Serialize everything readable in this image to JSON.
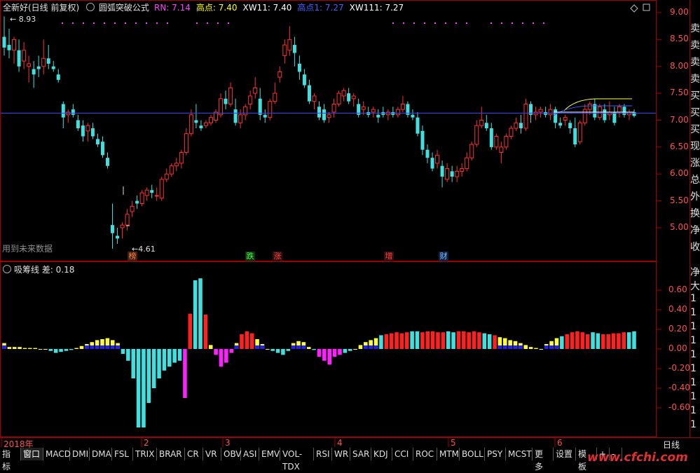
{
  "header": {
    "stock_name": "全新好(日线 前复权)",
    "formula_name": "圆弧突破公式",
    "indicators": [
      {
        "label": "RN: 7.14",
        "color": "#ff40ff"
      },
      {
        "label": "高点: 7.40",
        "color": "#ffff00"
      },
      {
        "label": "XW11: 7.40",
        "color": "#ffffff"
      },
      {
        "label": "高点1: 7.27",
        "color": "#4060ff"
      },
      {
        "label": "XW111: 7.27",
        "color": "#ffffff"
      }
    ]
  },
  "main_chart": {
    "price_axis": [
      "9.00",
      "8.50",
      "8.00",
      "7.50",
      "7.00",
      "6.50",
      "6.00",
      "5.50",
      "5.00"
    ],
    "high_label": "8.93",
    "low_label": "4.61",
    "future_data_note": "用到未来数据",
    "reference_level": 7.13,
    "markers": [
      {
        "text": "榜",
        "color": "#ff8040",
        "bg": "#402010"
      },
      {
        "text": "跌",
        "color": "#40ff40",
        "bg": "#103010"
      },
      {
        "text": "涨",
        "color": "#ff4040",
        "bg": "#301010"
      },
      {
        "text": "增",
        "color": "#ff4040",
        "bg": "#301010"
      },
      {
        "text": "财",
        "color": "#80c0ff",
        "bg": "#102040"
      }
    ]
  },
  "sub_chart": {
    "title": "吸筹线 差: 0.18",
    "axis": [
      "0.60",
      "0.40",
      "0.20",
      "0.00",
      "-0.20",
      "-0.40",
      "-0.60"
    ]
  },
  "time_axis": {
    "labels": [
      "2018年",
      "2",
      "3",
      "4",
      "5",
      "6"
    ],
    "period_button": "日线"
  },
  "right_panel_chars": [
    "卖",
    "卖",
    "卖",
    "卖",
    "买",
    "买",
    "买",
    "现",
    "涨",
    "总",
    "外",
    "换",
    "净",
    "收"
  ],
  "right_panel_chars_lower": [
    "净",
    "大",
    "1",
    "1",
    "1",
    "1",
    "1",
    "1",
    "1",
    "1",
    "1",
    "1"
  ],
  "toolbar": [
    "指标",
    "窗口",
    "MACD",
    "DMI",
    "DMA",
    "FSL",
    "TRIX",
    "BRAR",
    "CR",
    "VR",
    "OBV",
    "ASI",
    "EMV",
    "VOL-TDX",
    "RSI",
    "WR",
    "SAR",
    "KDJ",
    "CCI",
    "ROC",
    "MTM",
    "BOLL",
    "PSY",
    "MCST",
    "更多",
    "设置",
    "模板",
    "+",
    "-"
  ],
  "watermark": "www.cfchi.com",
  "chart_data": [
    {
      "type": "candlestick",
      "title": "圆弧突破公式",
      "y_range": [
        4.4,
        9.2
      ],
      "series_note": "daily OHLC, values estimated from axis",
      "candles": [
        [
          8.55,
          8.93,
          8.2,
          8.35
        ],
        [
          8.4,
          8.7,
          8.15,
          8.3
        ],
        [
          8.3,
          8.55,
          8.05,
          8.5
        ],
        [
          8.3,
          8.5,
          7.9,
          8.0
        ],
        [
          8.1,
          8.45,
          7.95,
          8.3
        ],
        [
          8.0,
          8.2,
          7.7,
          8.05
        ],
        [
          7.95,
          8.1,
          7.6,
          7.85
        ],
        [
          8.0,
          8.2,
          7.8,
          7.95
        ],
        [
          8.0,
          8.5,
          7.85,
          8.15
        ],
        [
          8.15,
          8.4,
          7.95,
          8.05
        ],
        [
          8.0,
          8.1,
          7.9,
          7.95
        ],
        [
          7.85,
          7.95,
          7.7,
          7.75
        ],
        [
          7.3,
          7.35,
          6.85,
          7.05
        ],
        [
          7.1,
          7.2,
          6.95,
          7.15
        ],
        [
          7.2,
          7.3,
          7.05,
          7.1
        ],
        [
          7.0,
          7.1,
          6.8,
          6.85
        ],
        [
          6.9,
          7.0,
          6.6,
          6.7
        ],
        [
          6.8,
          6.95,
          6.6,
          6.9
        ],
        [
          6.85,
          6.95,
          6.65,
          6.7
        ],
        [
          6.65,
          6.75,
          6.5,
          6.55
        ],
        [
          6.6,
          6.7,
          6.3,
          6.35
        ],
        [
          6.3,
          6.4,
          6.1,
          6.15
        ],
        [
          5.05,
          5.45,
          4.61,
          4.9
        ],
        [
          4.85,
          5.0,
          4.7,
          4.8
        ],
        [
          5.0,
          5.1,
          4.8,
          5.05
        ],
        [
          5.05,
          5.35,
          4.95,
          5.25
        ],
        [
          5.3,
          5.5,
          5.2,
          5.4
        ],
        [
          5.5,
          5.6,
          5.35,
          5.45
        ],
        [
          5.45,
          5.7,
          5.4,
          5.65
        ],
        [
          5.6,
          5.75,
          5.5,
          5.7
        ],
        [
          5.7,
          5.8,
          5.55,
          5.65
        ],
        [
          5.6,
          5.75,
          5.5,
          5.6
        ],
        [
          5.55,
          5.95,
          5.5,
          5.9
        ],
        [
          5.9,
          6.1,
          5.85,
          6.0
        ],
        [
          6.0,
          6.2,
          5.95,
          6.15
        ],
        [
          6.15,
          6.3,
          6.05,
          6.2
        ],
        [
          6.2,
          6.45,
          6.1,
          6.4
        ],
        [
          6.4,
          6.85,
          6.35,
          6.75
        ],
        [
          6.75,
          7.2,
          6.7,
          7.1
        ],
        [
          7.0,
          7.3,
          6.85,
          6.95
        ],
        [
          6.9,
          7.0,
          6.8,
          6.85
        ],
        [
          6.9,
          7.0,
          6.85,
          6.95
        ],
        [
          6.95,
          7.1,
          6.9,
          7.05
        ],
        [
          7.0,
          7.2,
          6.95,
          7.15
        ],
        [
          7.1,
          7.5,
          7.05,
          7.4
        ],
        [
          7.4,
          7.55,
          7.2,
          7.3
        ],
        [
          7.3,
          7.7,
          7.25,
          7.6
        ],
        [
          7.2,
          7.4,
          6.9,
          6.95
        ],
        [
          6.95,
          7.2,
          6.85,
          7.1
        ],
        [
          7.1,
          7.3,
          7.0,
          7.25
        ],
        [
          7.3,
          7.55,
          7.2,
          7.45
        ],
        [
          7.5,
          7.8,
          7.4,
          7.6
        ],
        [
          7.4,
          7.6,
          7.0,
          7.1
        ],
        [
          7.1,
          7.2,
          6.95,
          7.05
        ],
        [
          7.05,
          7.4,
          7.0,
          7.35
        ],
        [
          7.35,
          7.7,
          7.3,
          7.5
        ],
        [
          7.8,
          8.0,
          7.7,
          7.9
        ],
        [
          8.2,
          8.5,
          8.05,
          8.4
        ],
        [
          8.3,
          8.75,
          8.2,
          8.5
        ],
        [
          8.4,
          8.55,
          8.0,
          8.25
        ],
        [
          8.05,
          8.2,
          7.75,
          7.9
        ],
        [
          7.85,
          7.95,
          7.6,
          7.65
        ],
        [
          7.65,
          7.75,
          7.3,
          7.35
        ],
        [
          7.35,
          7.5,
          7.2,
          7.45
        ],
        [
          7.25,
          7.35,
          7.0,
          7.05
        ],
        [
          7.2,
          7.3,
          6.95,
          7.0
        ],
        [
          7.05,
          7.15,
          6.95,
          7.1
        ],
        [
          7.15,
          7.4,
          7.05,
          7.3
        ],
        [
          7.3,
          7.55,
          7.25,
          7.5
        ],
        [
          7.45,
          7.6,
          7.35,
          7.55
        ],
        [
          7.5,
          7.6,
          7.3,
          7.35
        ],
        [
          7.4,
          7.5,
          7.25,
          7.45
        ],
        [
          7.3,
          7.4,
          7.05,
          7.1
        ],
        [
          7.2,
          7.35,
          7.1,
          7.25
        ],
        [
          7.15,
          7.25,
          7.05,
          7.1
        ],
        [
          7.15,
          7.25,
          7.05,
          7.2
        ],
        [
          7.1,
          7.2,
          6.95,
          7.05
        ],
        [
          7.15,
          7.25,
          7.05,
          7.1
        ],
        [
          7.1,
          7.2,
          7.0,
          7.15
        ],
        [
          7.15,
          7.25,
          7.05,
          7.1
        ],
        [
          7.1,
          7.25,
          7.05,
          7.2
        ],
        [
          7.2,
          7.45,
          7.15,
          7.3
        ],
        [
          7.3,
          7.35,
          7.05,
          7.1
        ],
        [
          7.1,
          7.2,
          7.0,
          7.05
        ],
        [
          7.05,
          7.15,
          6.7,
          6.75
        ],
        [
          6.8,
          6.9,
          6.35,
          6.45
        ],
        [
          6.45,
          6.55,
          6.2,
          6.3
        ],
        [
          6.3,
          6.4,
          6.05,
          6.1
        ],
        [
          6.2,
          6.45,
          6.1,
          6.35
        ],
        [
          6.15,
          6.25,
          5.75,
          5.95
        ],
        [
          5.9,
          6.2,
          5.85,
          6.1
        ],
        [
          6.05,
          6.15,
          5.85,
          5.95
        ],
        [
          5.95,
          6.15,
          5.85,
          6.05
        ],
        [
          6.05,
          6.2,
          5.95,
          6.1
        ],
        [
          6.1,
          6.4,
          6.05,
          6.3
        ],
        [
          6.3,
          6.6,
          6.25,
          6.55
        ],
        [
          6.55,
          7.0,
          6.5,
          6.9
        ],
        [
          6.9,
          7.25,
          6.85,
          7.0
        ],
        [
          6.95,
          7.1,
          6.8,
          6.85
        ],
        [
          6.85,
          6.95,
          6.45,
          6.5
        ],
        [
          6.5,
          6.75,
          6.45,
          6.7
        ],
        [
          6.4,
          6.6,
          6.2,
          6.5
        ],
        [
          6.5,
          6.75,
          6.45,
          6.7
        ],
        [
          6.7,
          6.9,
          6.65,
          6.85
        ],
        [
          6.85,
          7.05,
          6.8,
          6.95
        ],
        [
          6.95,
          7.1,
          6.75,
          6.85
        ],
        [
          6.85,
          7.4,
          6.8,
          7.3
        ],
        [
          7.3,
          7.35,
          6.95,
          7.1
        ],
        [
          7.1,
          7.25,
          7.0,
          7.15
        ],
        [
          7.15,
          7.25,
          7.05,
          7.2
        ],
        [
          7.15,
          7.25,
          7.05,
          7.1
        ],
        [
          7.1,
          7.3,
          7.0,
          7.2
        ],
        [
          7.2,
          7.25,
          6.85,
          6.95
        ],
        [
          6.95,
          7.05,
          6.85,
          6.9
        ],
        [
          7.0,
          7.1,
          6.9,
          7.05
        ],
        [
          6.95,
          7.0,
          6.75,
          6.85
        ],
        [
          6.85,
          7.05,
          6.5,
          6.55
        ],
        [
          6.6,
          7.0,
          6.55,
          6.95
        ],
        [
          6.95,
          7.3,
          6.9,
          7.2
        ],
        [
          7.2,
          7.35,
          7.1,
          7.3
        ],
        [
          7.3,
          7.4,
          7.0,
          7.05
        ],
        [
          7.05,
          7.3,
          7.0,
          7.25
        ],
        [
          7.2,
          7.3,
          6.95,
          7.0
        ],
        [
          7.1,
          7.35,
          7.0,
          7.15
        ],
        [
          7.15,
          7.25,
          6.9,
          6.95
        ],
        [
          7.15,
          7.3,
          7.05,
          7.25
        ],
        [
          7.25,
          7.3,
          7.05,
          7.1
        ],
        [
          7.1,
          7.2,
          7.0,
          7.15
        ],
        [
          7.15,
          7.2,
          7.05,
          7.08
        ]
      ],
      "lines": [
        {
          "name": "高点",
          "color": "#ffff00"
        },
        {
          "name": "高点1",
          "color": "#4060ff"
        }
      ]
    },
    {
      "type": "bar",
      "title": "吸筹线 差: 0.18",
      "ylim": [
        -0.75,
        0.8
      ],
      "values": [
        0.06,
        0.02,
        0.02,
        0.02,
        0.01,
        0.01,
        0.01,
        0.0,
        0.0,
        -0.02,
        -0.04,
        -0.03,
        -0.02,
        -0.01,
        0.01,
        0.03,
        0.05,
        0.07,
        0.09,
        0.1,
        0.11,
        0.09,
        0.06,
        -0.05,
        -0.12,
        -0.3,
        -0.8,
        -0.8,
        -0.55,
        -0.4,
        -0.3,
        -0.22,
        -0.18,
        -0.14,
        -0.12,
        -0.5,
        0.36,
        0.7,
        0.72,
        0.35,
        0.04,
        -0.06,
        -0.18,
        -0.14,
        -0.04,
        0.06,
        0.15,
        0.18,
        0.16,
        0.1,
        0.05,
        0.0,
        -0.02,
        -0.04,
        -0.06,
        -0.02,
        0.06,
        0.08,
        0.07,
        0.02,
        -0.01,
        -0.08,
        -0.12,
        -0.16,
        -0.08,
        -0.06,
        -0.04,
        -0.02,
        0.0,
        0.04,
        0.07,
        0.09,
        0.11,
        0.14,
        0.15,
        0.16,
        0.17,
        0.16,
        0.17,
        0.18,
        0.18,
        0.17,
        0.18,
        0.18,
        0.17,
        0.17,
        0.18,
        0.17,
        0.18,
        0.18,
        0.17,
        0.18,
        0.17,
        0.16,
        0.15,
        0.14,
        0.12,
        0.11,
        0.09,
        0.08,
        0.06,
        0.04,
        0.02,
        0.01,
        0.0,
        0.05,
        0.08,
        0.11,
        0.13,
        0.15,
        0.17,
        0.18,
        0.17,
        0.15,
        0.17,
        0.16,
        0.15,
        0.15,
        0.16,
        0.16,
        0.17,
        0.17,
        0.18
      ]
    }
  ]
}
